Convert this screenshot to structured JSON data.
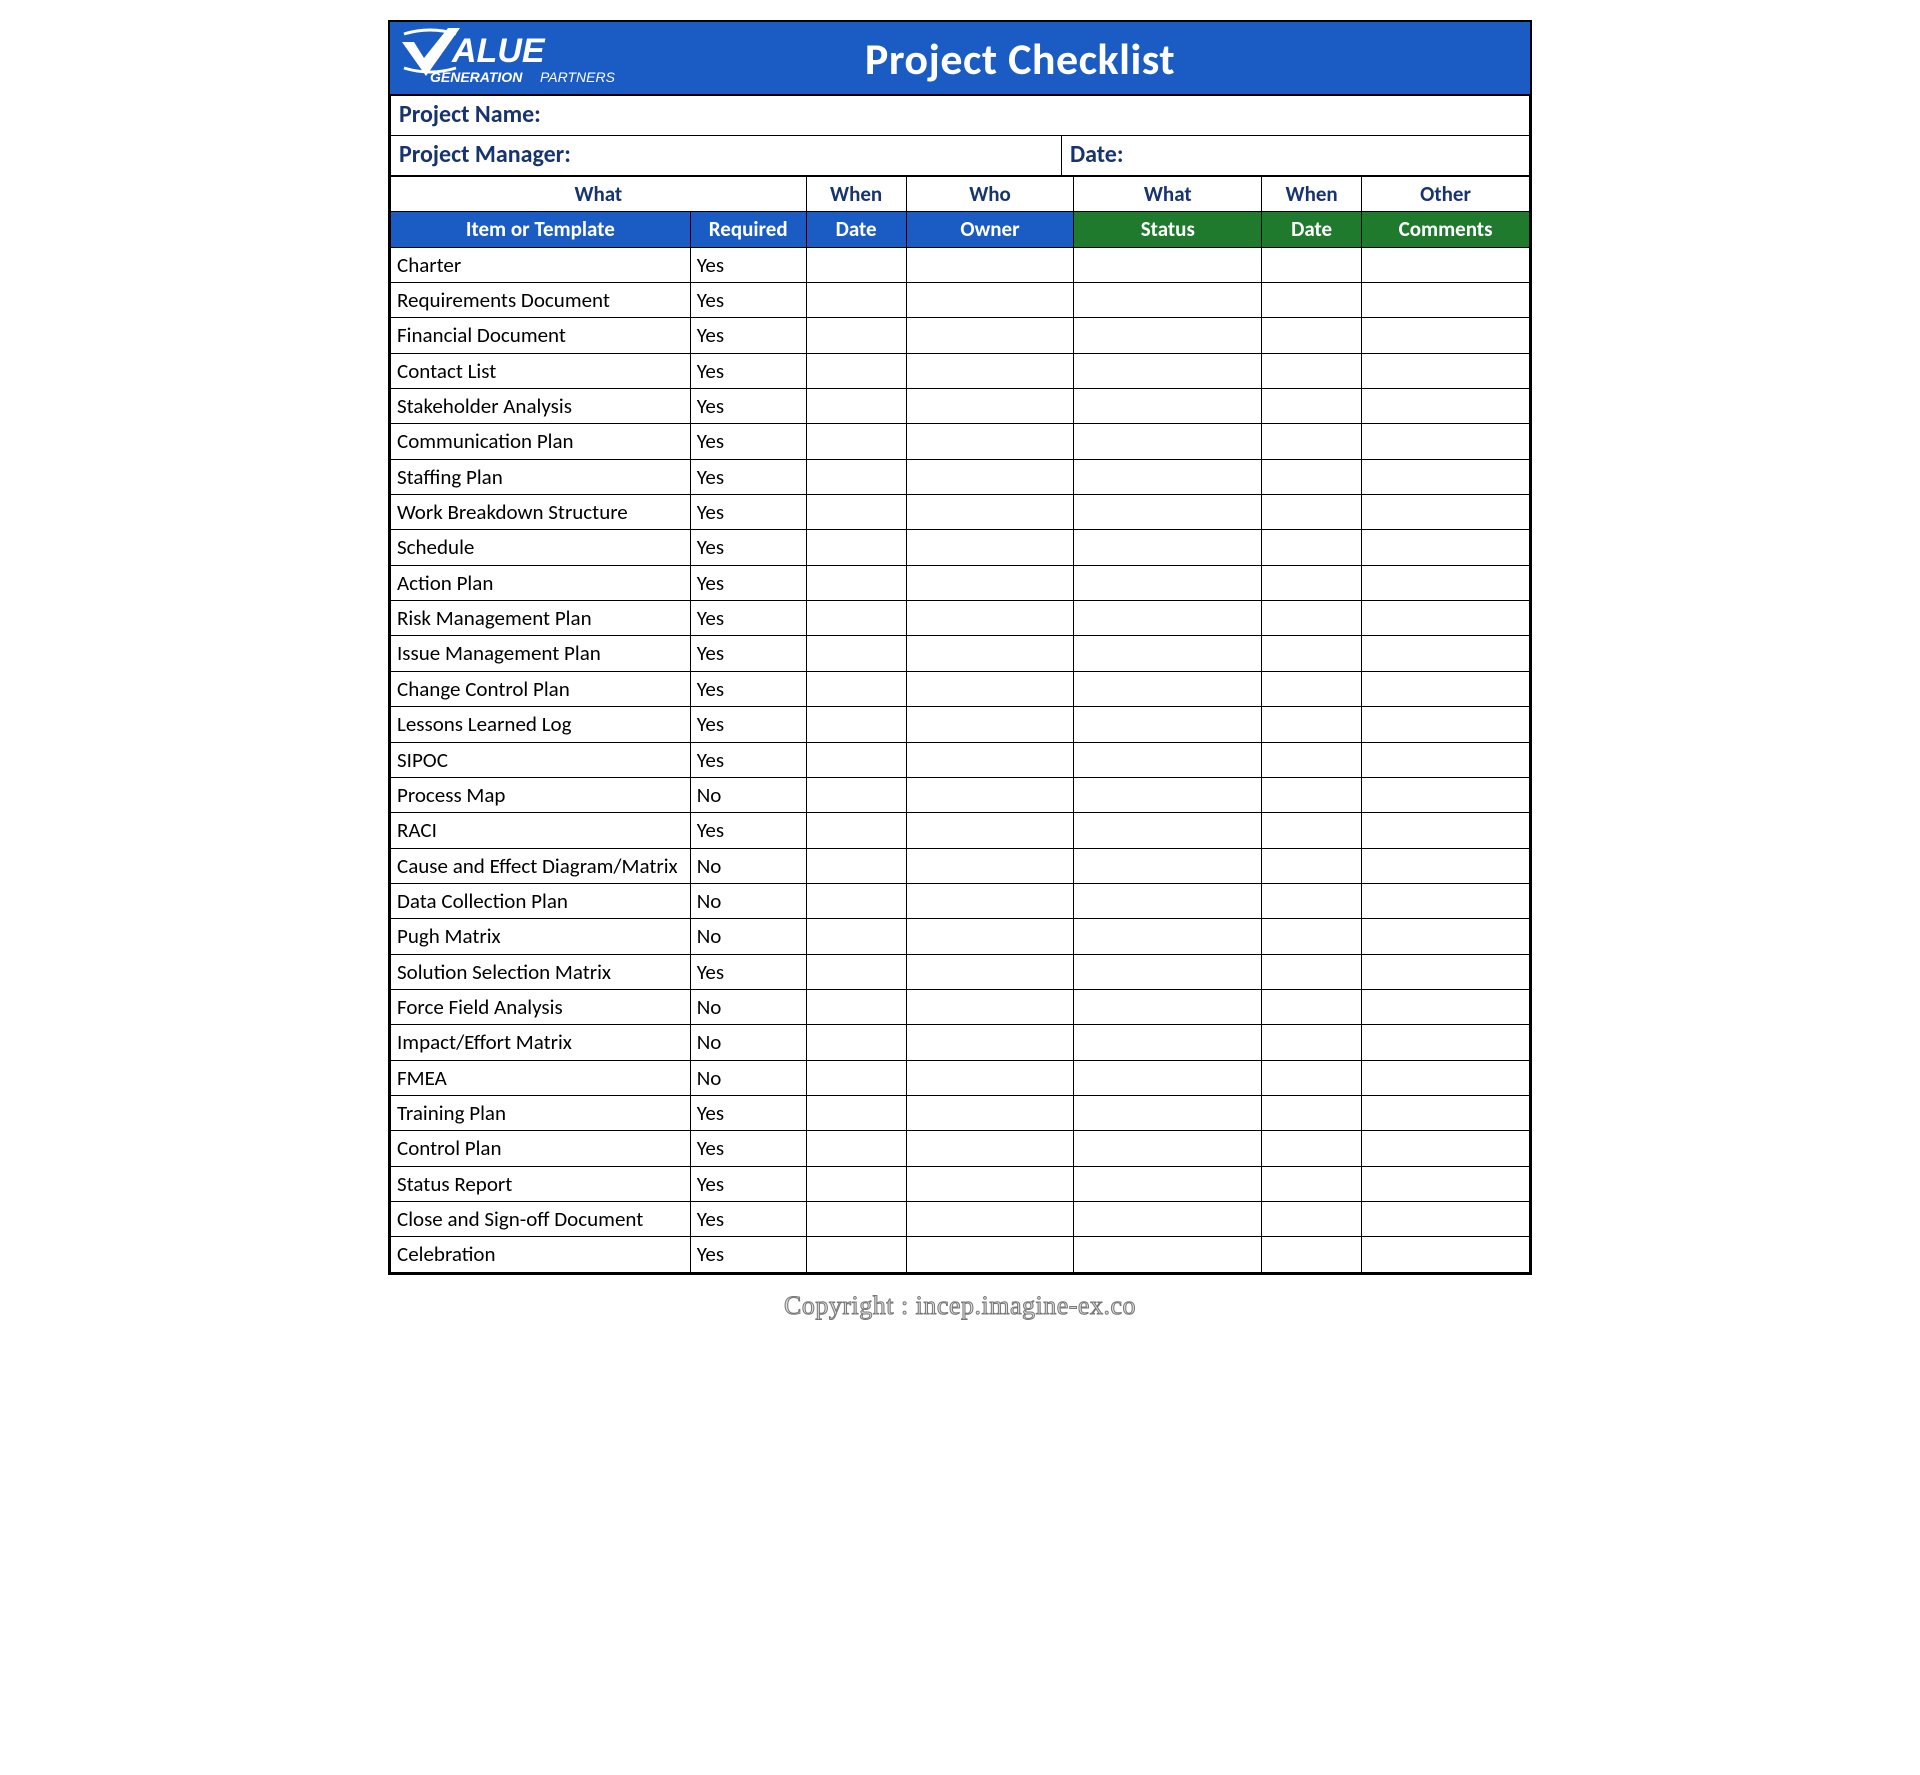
{
  "banner": {
    "title": "Project Checklist",
    "logo": {
      "top": "ALUE",
      "bottom_left": "GENERATION",
      "bottom_right": "PARTNERS"
    }
  },
  "meta": {
    "project_name_label": "Project Name:",
    "project_manager_label": "Project Manager:",
    "date_label": "Date:"
  },
  "headers": {
    "group": {
      "what1": "What",
      "when1": "When",
      "who": "Who",
      "what2": "What",
      "when2": "When",
      "other": "Other"
    },
    "cols": {
      "item": "Item or Template",
      "required": "Required",
      "date1": "Date",
      "owner": "Owner",
      "status": "Status",
      "date2": "Date",
      "comments": "Comments"
    }
  },
  "rows": [
    {
      "item": "Charter",
      "required": "Yes"
    },
    {
      "item": "Requirements Document",
      "required": "Yes"
    },
    {
      "item": "Financial Document",
      "required": "Yes"
    },
    {
      "item": "Contact List",
      "required": "Yes"
    },
    {
      "item": "Stakeholder Analysis",
      "required": "Yes"
    },
    {
      "item": "Communication Plan",
      "required": "Yes"
    },
    {
      "item": "Staffing Plan",
      "required": "Yes"
    },
    {
      "item": "Work Breakdown Structure",
      "required": "Yes"
    },
    {
      "item": "Schedule",
      "required": "Yes"
    },
    {
      "item": "Action Plan",
      "required": "Yes"
    },
    {
      "item": "Risk Management Plan",
      "required": "Yes"
    },
    {
      "item": "Issue Management Plan",
      "required": "Yes"
    },
    {
      "item": "Change Control Plan",
      "required": "Yes"
    },
    {
      "item": "Lessons Learned Log",
      "required": "Yes"
    },
    {
      "item": "SIPOC",
      "required": "Yes"
    },
    {
      "item": "Process Map",
      "required": "No"
    },
    {
      "item": "RACI",
      "required": "Yes"
    },
    {
      "item": "Cause and Effect Diagram/Matrix",
      "required": "No"
    },
    {
      "item": "Data Collection Plan",
      "required": "No"
    },
    {
      "item": "Pugh Matrix",
      "required": "No"
    },
    {
      "item": "Solution Selection Matrix",
      "required": "Yes"
    },
    {
      "item": "Force Field Analysis",
      "required": "No"
    },
    {
      "item": "Impact/Effort Matrix",
      "required": "No"
    },
    {
      "item": "FMEA",
      "required": "No"
    },
    {
      "item": "Training Plan",
      "required": "Yes"
    },
    {
      "item": "Control Plan",
      "required": "Yes"
    },
    {
      "item": "Status Report",
      "required": "Yes"
    },
    {
      "item": "Close and Sign-off Document",
      "required": "Yes"
    },
    {
      "item": "Celebration",
      "required": "Yes"
    }
  ],
  "copyright": "Copyright : incep.imagine-ex.co"
}
